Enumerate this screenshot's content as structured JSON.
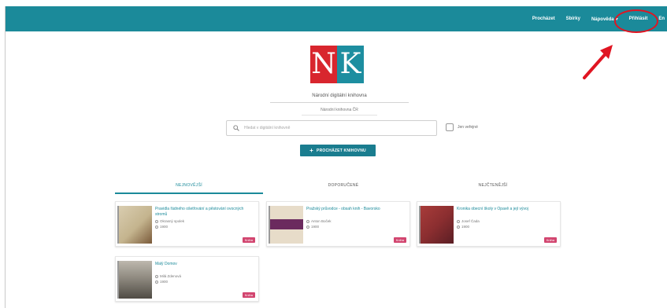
{
  "topbar": {
    "color": "#1b8a9a",
    "nav": [
      {
        "label": "Procházet",
        "dropdown": false
      },
      {
        "label": "Sbírky",
        "dropdown": false
      },
      {
        "label": "Nápověda",
        "dropdown": true
      },
      {
        "label": "Přihlásit",
        "dropdown": false
      },
      {
        "label": "En",
        "dropdown": false
      }
    ]
  },
  "annotation": {
    "color": "#e01522",
    "highlighted": "Přihlásit"
  },
  "logo": {
    "left": "N",
    "right": "K",
    "left_color": "#d8262e",
    "right_color": "#1d8ea0"
  },
  "library": {
    "name": "Národní digitální knihovna",
    "subtitle": "Národní knihovna ČR"
  },
  "search": {
    "placeholder": "Hledat v digitální knihovně",
    "public_only_label": "Jen veřejné"
  },
  "browse_button": {
    "label": "PROCHÁZET KNIHOVNU"
  },
  "tabs": [
    {
      "label": "NEJNOVĚJŠÍ",
      "active": true
    },
    {
      "label": "DOPORUČENÉ",
      "active": false
    },
    {
      "label": "NEJČTENĚJŠÍ",
      "active": false
    }
  ],
  "cards": [
    {
      "title": "Pravidla řádného ošetřování a pěstování ovocných stromů",
      "author": "Okrasný spolek",
      "date": "1900",
      "badge": "Kniha",
      "cover": [
        "#d9cdb0",
        "#7a5a3a"
      ]
    },
    {
      "title": "Pražský průvodce - obsah knih - Bavorsko",
      "author": "Anton Boček",
      "date": "1900",
      "badge": "Kniha",
      "cover": [
        "#e7dcc9",
        "#6b2a5e"
      ]
    },
    {
      "title": "Kronika obecní školy v Opavě a její vývoj",
      "author": "Josef Čada",
      "date": "1900",
      "badge": "Kniha",
      "cover": [
        "#a83c3a",
        "#5a1e24"
      ]
    },
    {
      "title": "Malý Domov",
      "author": "Milá Zdenová",
      "date": "1900",
      "badge": "Kniha",
      "cover": [
        "#bdb8ae",
        "#4f4b44"
      ]
    }
  ]
}
